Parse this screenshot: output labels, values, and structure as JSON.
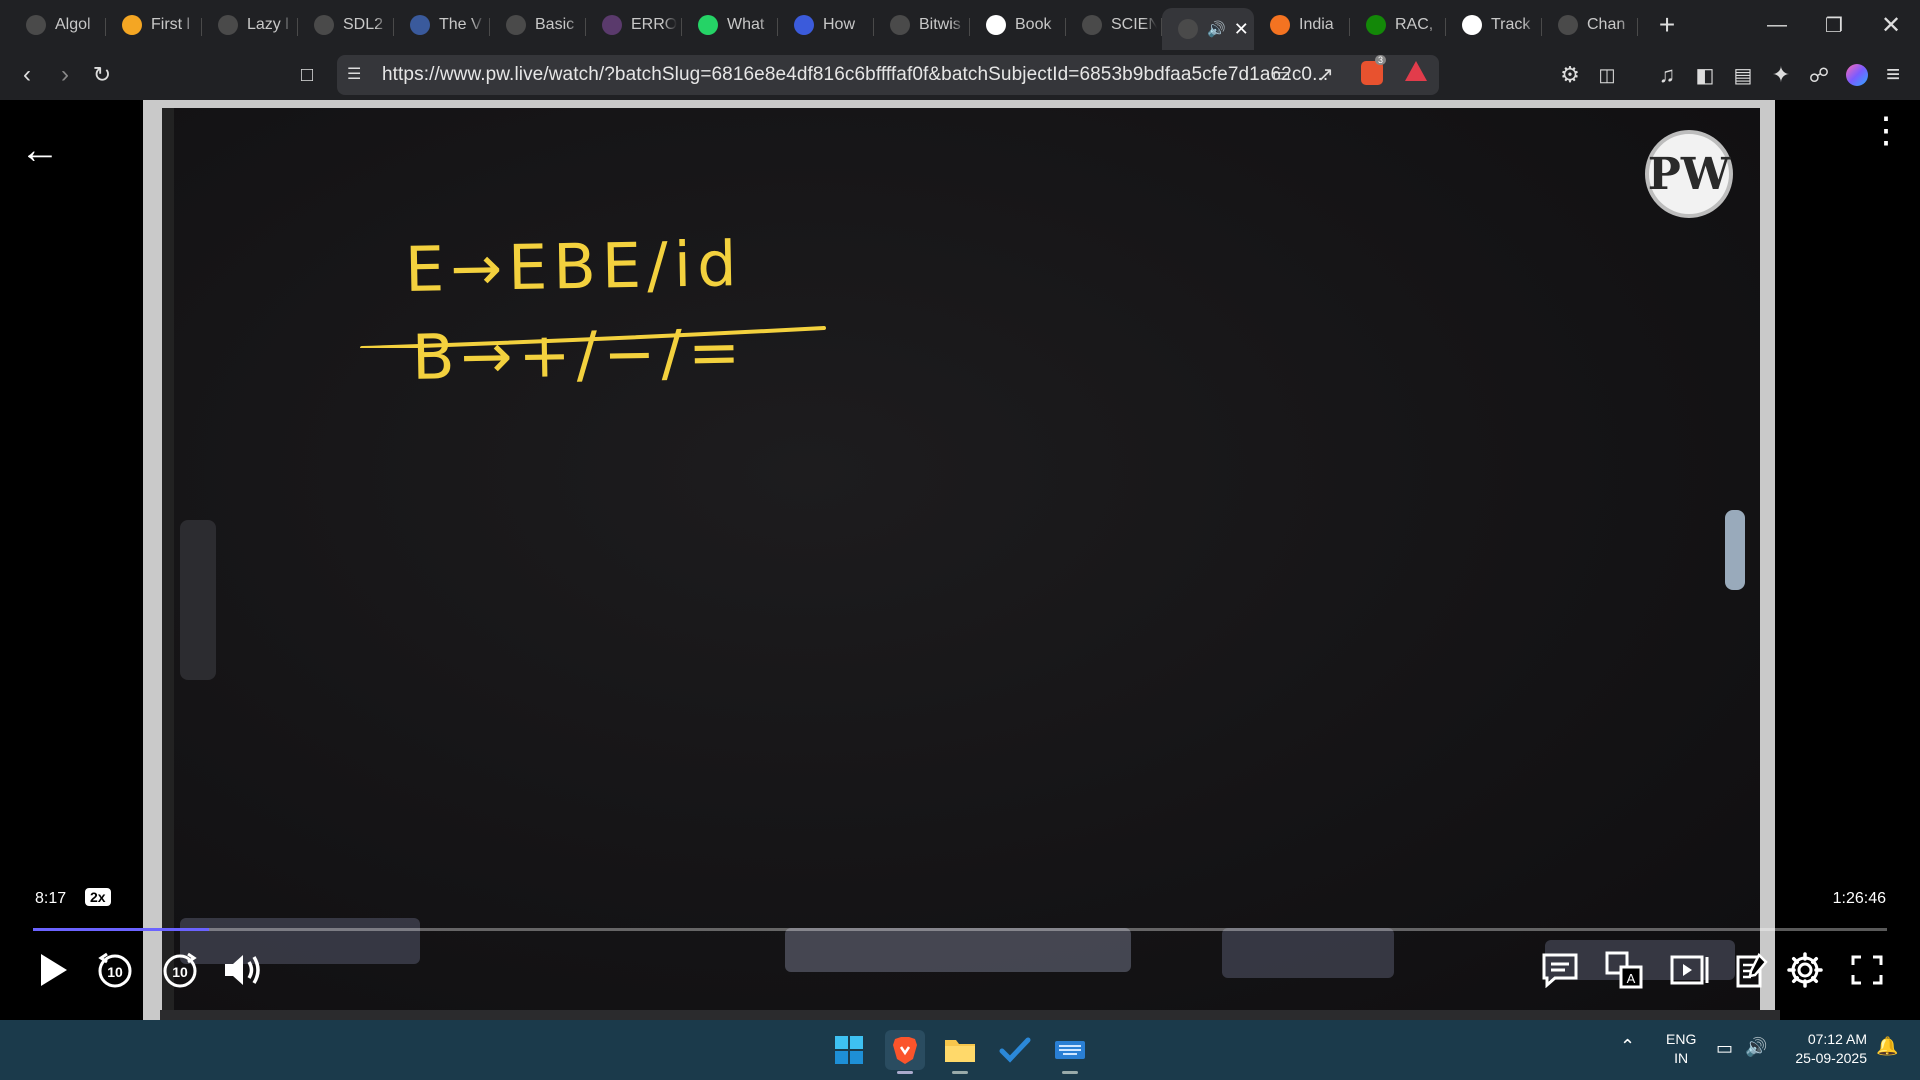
{
  "browser": {
    "tabs": [
      {
        "label": "Algol",
        "icon": "lens-icon",
        "color": "#4a4a4a"
      },
      {
        "label": "First l",
        "icon": "arrow-tab-icon",
        "color": "#f4a623"
      },
      {
        "label": "Lazy l",
        "icon": "globe-icon",
        "color": "#4a4a4a"
      },
      {
        "label": "SDL2",
        "icon": "globe-icon",
        "color": "#4a4a4a"
      },
      {
        "label": "The V",
        "icon": "wordpress-icon",
        "color": "#3a5a9c"
      },
      {
        "label": "Basic",
        "icon": "page-icon",
        "color": "#4a4a4a"
      },
      {
        "label": "ERRO",
        "icon": "globe-icon",
        "color": "#5a3a6c"
      },
      {
        "label": "What",
        "icon": "whatsapp-icon",
        "color": "#25d366"
      },
      {
        "label": "How",
        "icon": "shield-icon",
        "color": "#3b5bdb"
      },
      {
        "label": "Bitwis",
        "icon": "site-icon",
        "color": "#4a4a4a"
      },
      {
        "label": "Book",
        "icon": "google-icon",
        "color": "#ffffff"
      },
      {
        "label": "SCIEN",
        "icon": "globe-icon",
        "color": "#4a4a4a"
      },
      {
        "label": "",
        "icon": "pw-icon",
        "color": "#4a4a4a",
        "active": true
      },
      {
        "label": "India",
        "icon": "india-icon",
        "color": "#f47321"
      },
      {
        "label": "RAC,",
        "icon": "flag-icon",
        "color": "#138808"
      },
      {
        "label": "Track",
        "icon": "amazon-icon",
        "color": "#ffffff"
      },
      {
        "label": "Chan",
        "icon": "globe-icon",
        "color": "#4a4a4a"
      }
    ],
    "url": "https://www.pw.live/watch/?batchSlug=6816e8e4df816c6bffffaf0f&batchSubjectId=6853b9bdfaa5cfe7d1a62c0...",
    "brave_badge": "3"
  },
  "video": {
    "logo": "PW",
    "board_lines": [
      "E→EBE/id",
      "B→+/−/="
    ],
    "current_time": "8:17",
    "speed": "2x",
    "total_time": "1:26:46",
    "progress": 0.095,
    "controls": {
      "rewind": "10",
      "forward": "10"
    },
    "colors": {
      "chalk": "#f3d13e",
      "progress": "#6b63ff"
    }
  },
  "taskbar": {
    "lang_line1": "ENG",
    "lang_line2": "IN",
    "time": "07:12 AM",
    "date": "25-09-2025"
  }
}
